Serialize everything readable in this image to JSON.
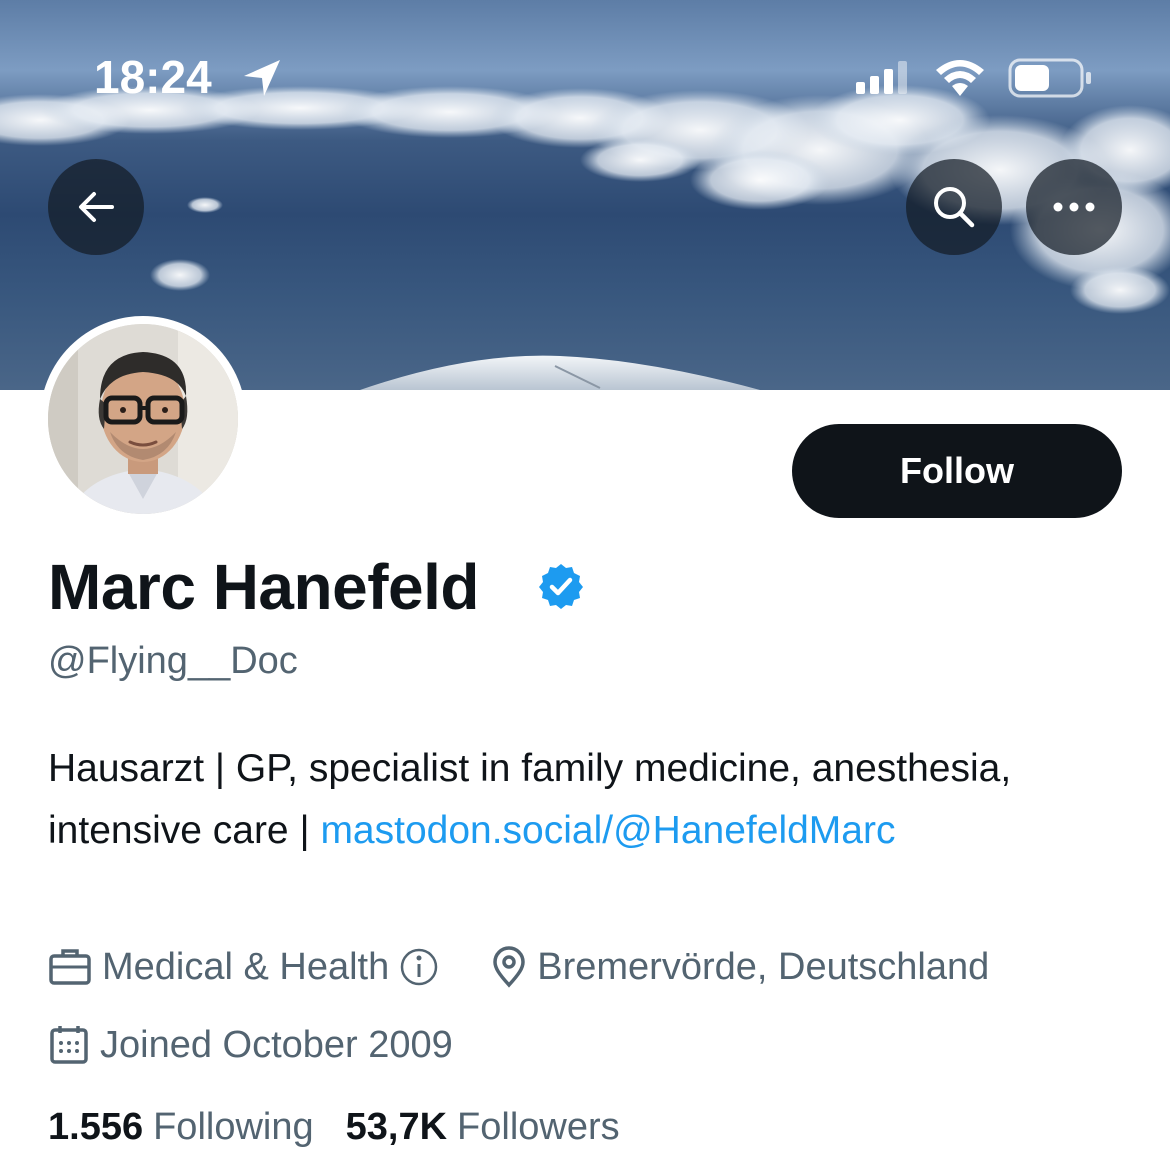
{
  "status_bar": {
    "time": "18:24"
  },
  "nav": {
    "back_icon": "arrow-left-icon",
    "search_icon": "search-icon",
    "more_icon": "more-dots-icon"
  },
  "profile": {
    "follow_label": "Follow",
    "display_name": "Marc Hanefeld",
    "handle": "@Flying__Doc",
    "bio_text": "Hausarzt | GP, specialist in family medicine, anesthesia, intensive care | ",
    "bio_link": "mastodon.social/@HanefeldMarc",
    "category": "Medical & Health",
    "location": "Bremervörde, Deutschland",
    "joined": "Joined October 2009",
    "following_count": "1.556",
    "following_label": "Following",
    "followers_count": "53,7K",
    "followers_label": "Followers"
  },
  "colors": {
    "accent": "#1d9bf0",
    "text_primary": "#0f1419",
    "text_secondary": "#536471",
    "button_dark": "#0f1419"
  }
}
